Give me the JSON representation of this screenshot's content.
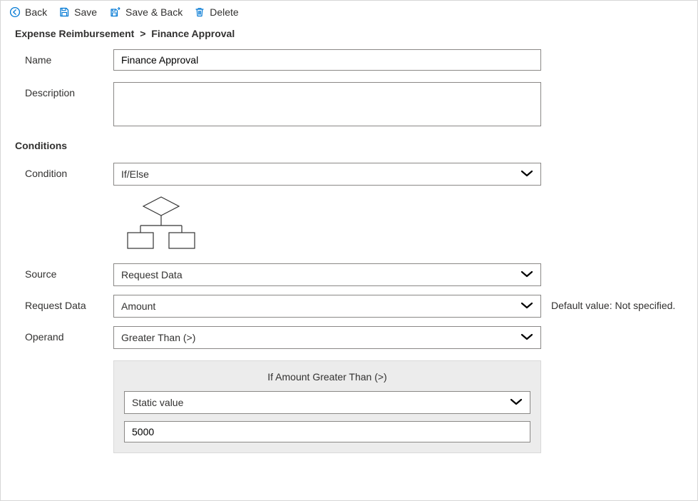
{
  "toolbar": {
    "back": "Back",
    "save": "Save",
    "save_back": "Save & Back",
    "delete": "Delete"
  },
  "breadcrumb": {
    "parent": "Expense Reimbursement",
    "sep": ">",
    "current": "Finance Approval"
  },
  "form": {
    "name_label": "Name",
    "name_value": "Finance Approval",
    "description_label": "Description",
    "description_value": ""
  },
  "conditions": {
    "heading": "Conditions",
    "condition_label": "Condition",
    "condition_value": "If/Else",
    "source_label": "Source",
    "source_value": "Request Data",
    "request_data_label": "Request Data",
    "request_data_value": "Amount",
    "request_data_note": "Default value: Not specified.",
    "operand_label": "Operand",
    "operand_value": "Greater Than (>)"
  },
  "cond_panel": {
    "title": "If Amount Greater Than (>)",
    "value_type": "Static value",
    "value": "5000"
  },
  "icons": {
    "back": "back-arrow-circle",
    "save": "floppy-disk",
    "save_back": "floppy-disk-arrow",
    "delete": "trash"
  },
  "colors": {
    "accent": "#0078d4",
    "border": "#8a8886",
    "panel": "#ececec"
  }
}
